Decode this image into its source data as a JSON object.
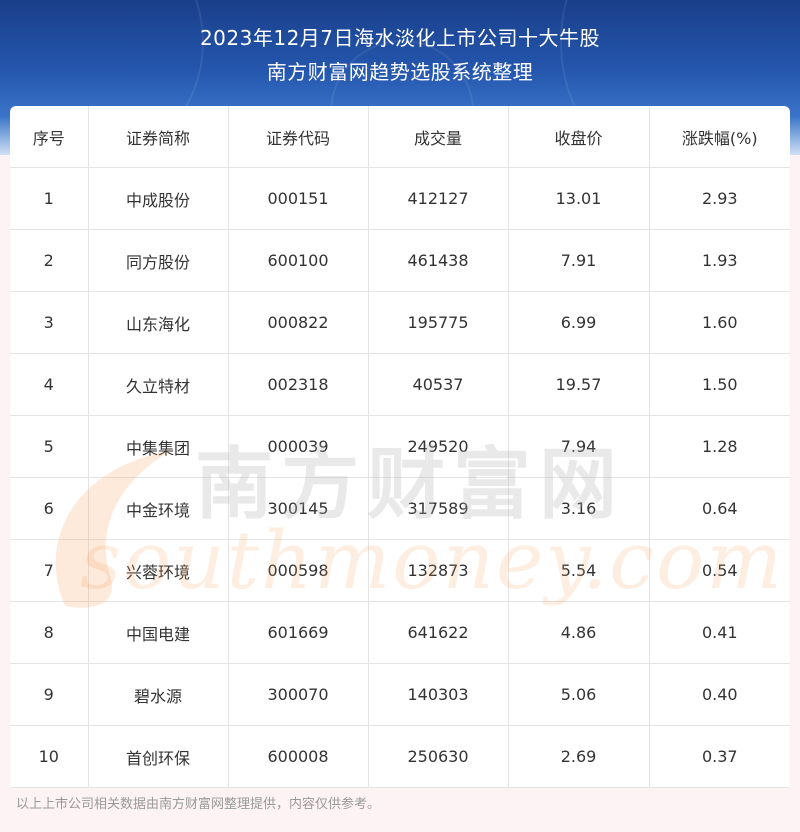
{
  "header": {
    "title_line1": "2023年12月7日海水淡化上市公司十大牛股",
    "title_line2": "南方财富网趋势选股系统整理"
  },
  "table": {
    "columns": [
      "序号",
      "证券简称",
      "证券代码",
      "成交量",
      "收盘价",
      "涨跌幅(%)"
    ],
    "rows": [
      [
        "1",
        "中成股份",
        "000151",
        "412127",
        "13.01",
        "2.93"
      ],
      [
        "2",
        "同方股份",
        "600100",
        "461438",
        "7.91",
        "1.93"
      ],
      [
        "3",
        "山东海化",
        "000822",
        "195775",
        "6.99",
        "1.60"
      ],
      [
        "4",
        "久立特材",
        "002318",
        "40537",
        "19.57",
        "1.50"
      ],
      [
        "5",
        "中集集团",
        "000039",
        "249520",
        "7.94",
        "1.28"
      ],
      [
        "6",
        "中金环境",
        "300145",
        "317589",
        "3.16",
        "0.64"
      ],
      [
        "7",
        "兴蓉环境",
        "000598",
        "132873",
        "5.54",
        "0.54"
      ],
      [
        "8",
        "中国电建",
        "601669",
        "641622",
        "4.86",
        "0.41"
      ],
      [
        "9",
        "碧水源",
        "300070",
        "140303",
        "5.06",
        "0.40"
      ],
      [
        "10",
        "首创环保",
        "600008",
        "250630",
        "2.69",
        "0.37"
      ]
    ]
  },
  "watermark": {
    "cn": "南方财富网",
    "en": "southmoney.com"
  },
  "footer": {
    "note": "以上上市公司相关数据由南方财富网整理提供，内容仅供参考。"
  },
  "colors": {
    "header_dark": "#1a3f8a",
    "header_light": "#3a74c9",
    "page_bg": "#fdf3f4",
    "text": "#333333",
    "grid": "#e4e4e4",
    "watermark_orange": "#f4a05a"
  }
}
